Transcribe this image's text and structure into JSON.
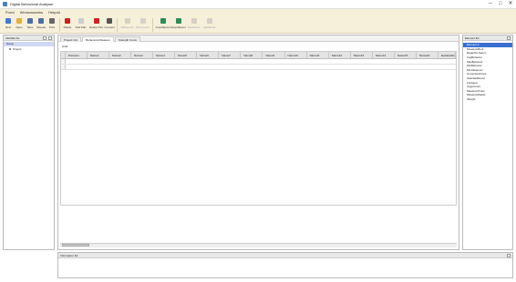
{
  "window": {
    "title": "Digital Behavioral Analyser",
    "minimize": "─",
    "maximize": "□",
    "close": "✕"
  },
  "menu": [
    "Fixed",
    "Windowssinks",
    "Helpdd"
  ],
  "toolbar": [
    {
      "label": "New",
      "icon": "new-file-icon",
      "color": "#3b7bd4",
      "enabled": true
    },
    {
      "label": "Open",
      "icon": "open-folder-icon",
      "color": "#e0b040",
      "enabled": true
    },
    {
      "label": "Save",
      "icon": "save-icon",
      "color": "#4a6fa5",
      "enabled": true
    },
    {
      "label": "Saveas",
      "icon": "save-as-icon",
      "color": "#4a6fa5",
      "enabled": true
    },
    {
      "label": "Print",
      "icon": "print-icon",
      "color": "#666666",
      "enabled": true
    },
    {
      "label": "Delete",
      "icon": "delete-icon",
      "color": "#cc2222",
      "enabled": true
    },
    {
      "label": "Add Part",
      "icon": "add-part-icon",
      "color": "#cccccc",
      "enabled": true
    },
    {
      "label": "Delete Part",
      "icon": "delete-part-icon",
      "color": "#cc2222",
      "enabled": true
    },
    {
      "label": "Connect",
      "icon": "connect-icon",
      "color": "#555555",
      "enabled": true
    },
    {
      "label": "Statement",
      "icon": "statement-icon",
      "color": "#999999",
      "enabled": false
    },
    {
      "label": "Disconnect",
      "icon": "disconnect-icon",
      "color": "#999999",
      "enabled": false
    },
    {
      "label": "ImportExcel",
      "icon": "import-excel-icon",
      "color": "#2e8b57",
      "enabled": true
    },
    {
      "label": "ExportExcel",
      "icon": "export-excel-icon",
      "color": "#2e8b57",
      "enabled": true
    },
    {
      "label": "StartExcel",
      "icon": "start-icon",
      "color": "#999999",
      "enabled": false
    },
    {
      "label": "StatiExcel",
      "icon": "stats-icon",
      "color": "#999999",
      "enabled": false
    }
  ],
  "left_panel": {
    "title": "Variable list",
    "tree_root": "Name",
    "tree_child": "Project"
  },
  "tabs": [
    "Project Info",
    "Behavioral Measure",
    "Strength Curve"
  ],
  "subhead": "Ardd",
  "grid_headers": [
    "Prename",
    "Name1",
    "Name2",
    "Name3",
    "Name4",
    "Name5",
    "Name6",
    "Name7",
    "Name8",
    "Name9",
    "Name10",
    "Name11",
    "Name12",
    "Name13",
    "Name14",
    "Name15",
    "Name16"
  ],
  "grid_last_header": "Explanation",
  "right_panel": {
    "title": "Element list",
    "items": [
      "Element A",
      "MeasureMent",
      "Ragezba Selem",
      "AvgBehavior",
      "MaxBehavior",
      "MinBehavior",
      "MinValueurer",
      "ComputedAmes",
      "StandardDevel",
      "Fertigure",
      "AngeCount",
      "MeasureTimes",
      "MeasureReads",
      "Weight"
    ],
    "selected_index": 0
  },
  "bottom_panel": {
    "title": "Information list"
  }
}
